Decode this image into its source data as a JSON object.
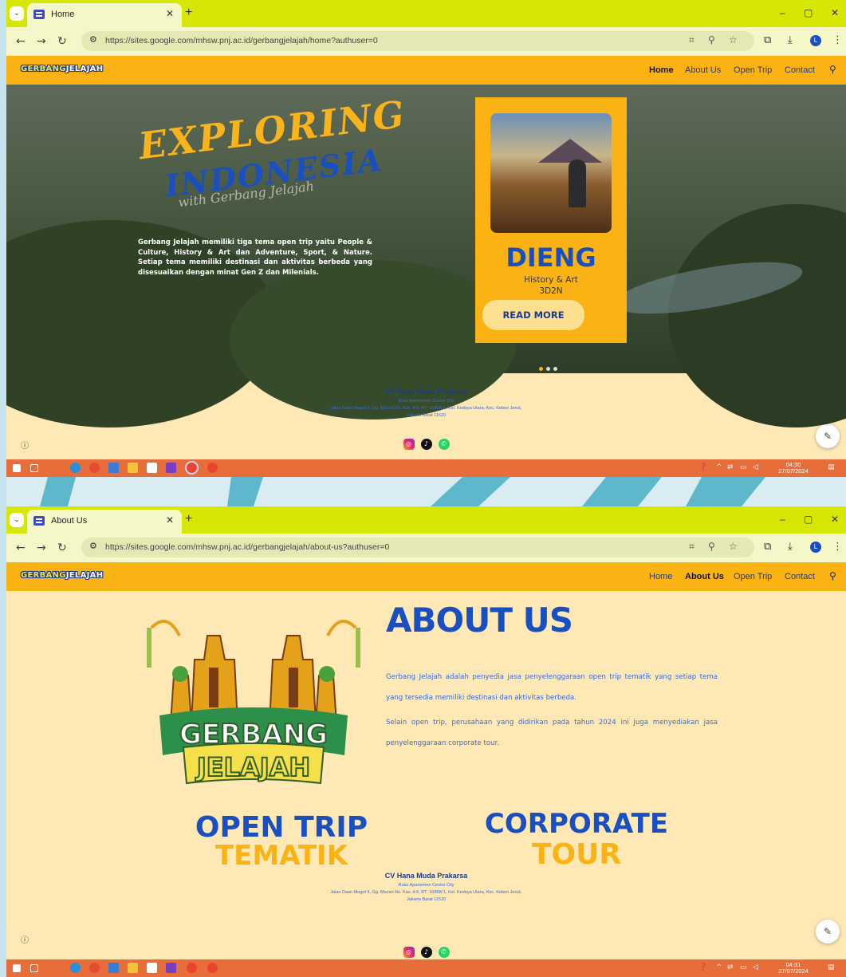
{
  "site": {
    "logo_text_1": "GERBANG",
    "logo_text_2": "JELAJAH",
    "menu": [
      "Home",
      "About Us",
      "Open Trip",
      "Contact"
    ]
  },
  "footer": {
    "company": "CV Hana Muda Prakarsa",
    "line1": "Ruko Apartemen Centro City",
    "line2": "Jalan Daan Mogot II, Gg. Macan No. Kav. 4-5, RT. 10/RW.1, Kel. Kedoya Utara, Kec. Kebon Jeruk,",
    "line3": "Jakarta Barat 11520",
    "social_icons": [
      "instagram-icon",
      "tiktok-icon",
      "whatsapp-icon"
    ]
  },
  "colors": {
    "browser_frame": "#d7e705",
    "site_header": "#fbb313",
    "page_bg": "#fde8b6",
    "brand_blue": "#1a4fc0",
    "taskbar": "#e76d3b"
  },
  "screen1": {
    "tab_title": "Home",
    "url": "https://sites.google.com/mhsw.pnj.ac.id/gerbangjelajah/home?authuser=0",
    "active_menu": "Home",
    "hero": {
      "headline1": "EXPLORING",
      "headline2": "INDONESIA",
      "tagline": "with Gerbang Jelajah",
      "description": "Gerbang Jelajah memiliki tiga tema open trip yaitu People & Culture, History & Art dan Adventure, Sport, & Nature. Setiap tema memiliki destinasi dan aktivitas berbeda yang disesuaikan dengan minat Gen Z dan Milenials.",
      "card": {
        "destination": "DIENG",
        "theme": "History & Art",
        "duration": "3D2N",
        "button": "READ MORE"
      },
      "slides_total": 3,
      "slide_active": 1
    },
    "clock_time": "04:30",
    "clock_date": "27/07/2024"
  },
  "screen2": {
    "tab_title": "About Us",
    "url": "https://sites.google.com/mhsw.pnj.ac.id/gerbangjelajah/about-us?authuser=0",
    "active_menu": "About Us",
    "title": "ABOUT US",
    "paragraph1": "Gerbang Jelajah adalah penyedia jasa penyelenggaraan open trip tematik yang setiap tema yang tersedia memiliki destinasi dan aktivitas berbeda.",
    "paragraph2": "Selain open trip, perusahaan yang didirikan pada tahun 2024 ini juga menyediakan jasa penyelenggaraan corporate tour.",
    "emblem_word1": "GERBANG",
    "emblem_word2": "JELAJAH",
    "service1_line1": "OPEN TRIP",
    "service1_line2": "TEMATIK",
    "service2_line1": "CORPORATE",
    "service2_line2": "TOUR",
    "clock_time": "04:31",
    "clock_date": "27/07/2024"
  }
}
